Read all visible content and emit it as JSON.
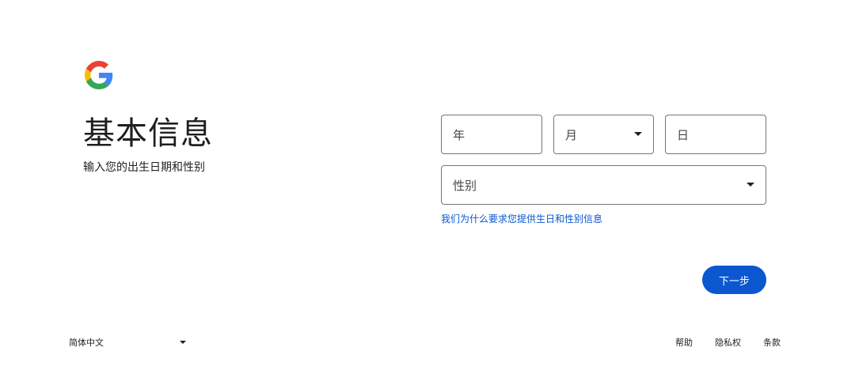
{
  "logo": {
    "icon": "google-g-logo-icon",
    "colors": {
      "blue": "#4285F4",
      "red": "#EA4335",
      "yellow": "#FBBC05",
      "green": "#34A853"
    }
  },
  "header": {
    "title": "基本信息",
    "subtitle": "输入您的出生日期和性别"
  },
  "form": {
    "year_placeholder": "年",
    "month_placeholder": "月",
    "day_placeholder": "日",
    "gender_placeholder": "性别",
    "why_link": "我们为什么要求您提供生日和性别信息"
  },
  "actions": {
    "next_label": "下一步",
    "accent": "#0b57d0"
  },
  "footer": {
    "language": "简体中文",
    "links": [
      "帮助",
      "隐私权",
      "条款"
    ]
  }
}
